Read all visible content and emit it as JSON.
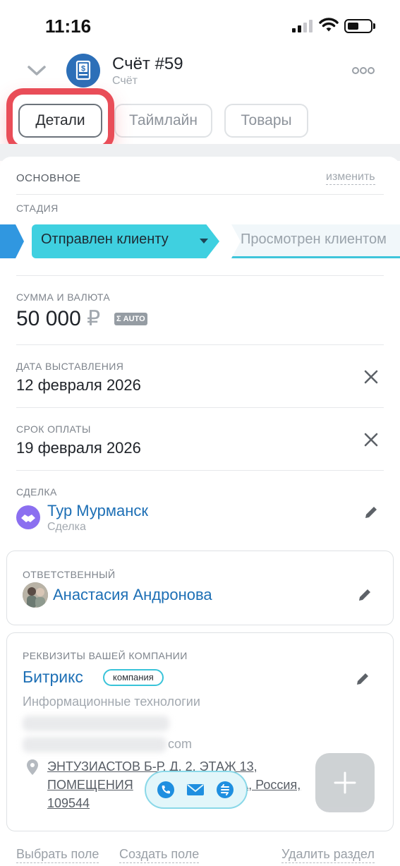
{
  "status_bar": {
    "time": "11:16"
  },
  "header": {
    "title": "Счёт #59",
    "subtitle": "Счёт"
  },
  "tabs": [
    {
      "label": "Детали",
      "active": true
    },
    {
      "label": "Таймлайн",
      "active": false
    },
    {
      "label": "Товары",
      "active": false
    }
  ],
  "section": {
    "title": "ОСНОВНОЕ",
    "edit_label": "изменить"
  },
  "stage": {
    "label": "СТАДИЯ",
    "current": "Отправлен клиенту",
    "next": "Просмотрен клиентом"
  },
  "amount": {
    "label": "СУММА И ВАЛЮТА",
    "value": "50 000",
    "currency": "₽",
    "badge": "AUTO"
  },
  "issue_date": {
    "label": "ДАТА ВЫСТАВЛЕНИЯ",
    "value": "12 февраля 2026"
  },
  "due_date": {
    "label": "СРОК ОПЛАТЫ",
    "value": "19 февраля 2026"
  },
  "deal": {
    "label": "СДЕЛКА",
    "name": "Тур Мурманск",
    "type": "Сделка"
  },
  "responsible": {
    "label": "ОТВЕТСТВЕННЫЙ",
    "name": "Анастасия Андронова"
  },
  "company": {
    "label": "РЕКВИЗИТЫ ВАШЕЙ КОМПАНИИ",
    "name": "Битрикс",
    "badge": "компания",
    "industry": "Информационные технологии",
    "email_suffix": "com",
    "address_line1": "ЭНТУЗИАСТОВ Б-Р, Д. 2, ЭТАЖ 13,",
    "address_line2_start": "ПОМЕЩЕНИЯ",
    "address_line2_end": "ВА, Россия,",
    "address_line3": "109544"
  },
  "footer": {
    "select_field": "Выбрать поле",
    "create_field": "Создать поле",
    "delete_section": "Удалить раздел"
  },
  "colors": {
    "accent_blue": "#1d6fb5",
    "stage_current": "#3fd0e0",
    "highlight_red": "#e94d58"
  },
  "icons": [
    "chevron-down-icon",
    "invoice-icon",
    "more-icon",
    "close-icon",
    "pencil-icon",
    "handshake-icon",
    "location-pin-icon",
    "phone-icon",
    "mail-icon",
    "chat-icon",
    "plus-icon"
  ]
}
